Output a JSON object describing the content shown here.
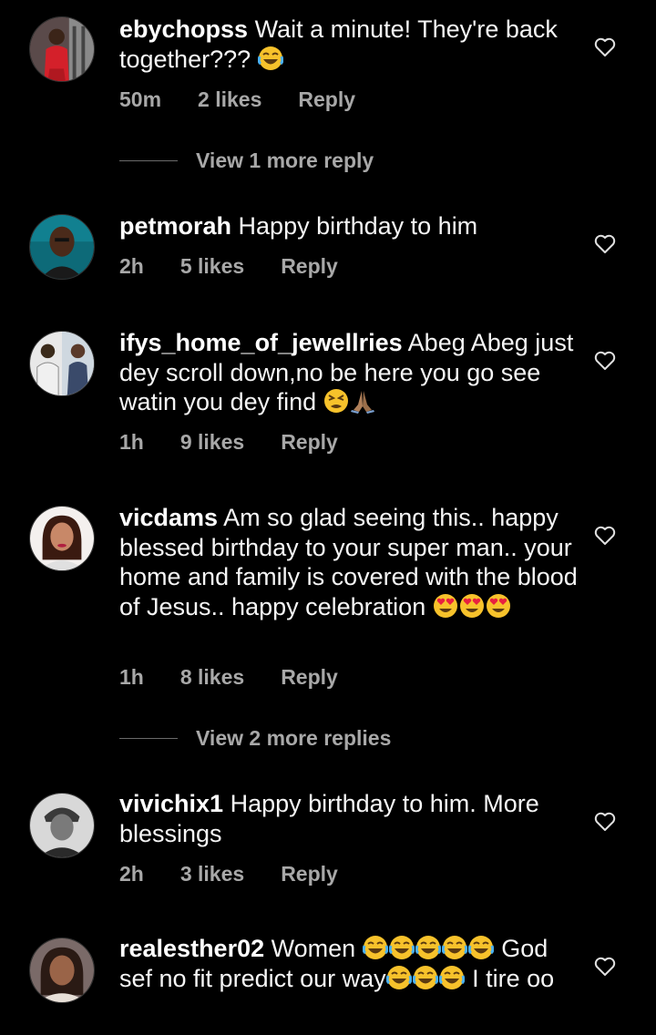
{
  "comments": [
    {
      "username": "ebychopss",
      "text": "Wait a minute! They're back together???",
      "emojis": [
        "laugh-cry"
      ],
      "time": "50m",
      "likes": "2 likes",
      "reply": "Reply",
      "view_more": "View 1 more reply"
    },
    {
      "username": "petmorah",
      "text": "Happy birthday to him",
      "emojis": [],
      "time": "2h",
      "likes": "5 likes",
      "reply": "Reply"
    },
    {
      "username": "ifys_home_of_jewellries",
      "text": "Abeg Abeg just dey scroll down,no be here you go see watin you dey find",
      "emojis": [
        "tired-face",
        "folded-hands"
      ],
      "time": "1h",
      "likes": "9 likes",
      "reply": "Reply"
    },
    {
      "username": "vicdams",
      "text": "Am so glad seeing this.. happy blessed birthday to your super man.. your home and family is covered with the blood of Jesus.. happy celebration",
      "emojis": [
        "heart-eyes",
        "heart-eyes",
        "heart-eyes"
      ],
      "time": "1h",
      "likes": "8 likes",
      "reply": "Reply",
      "view_more": "View 2 more replies"
    },
    {
      "username": "vivichix1",
      "text": "Happy birthday to him. More blessings",
      "emojis": [],
      "time": "2h",
      "likes": "3 likes",
      "reply": "Reply"
    },
    {
      "username": "realesther02",
      "text_1": "Women",
      "text_2": "God sef no fit predict our way",
      "text_3": "I tire oo",
      "emojis": [
        "laugh-cry"
      ]
    }
  ],
  "colors": {
    "background": "#000000",
    "text": "#f5f5f5",
    "secondary": "#a8a8a8"
  },
  "icons": {
    "like": "heart-outline-icon"
  }
}
